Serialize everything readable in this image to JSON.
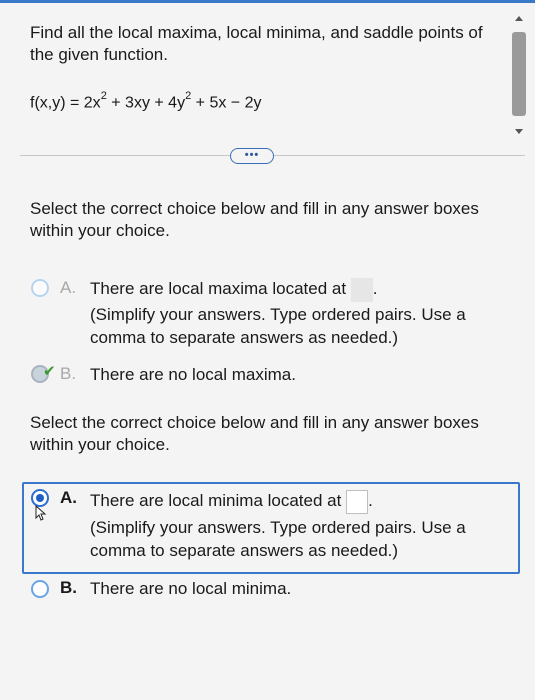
{
  "question": {
    "prompt": "Find all the local maxima, local minima, and saddle points of the given function.",
    "formula": {
      "lhs": "f(x,y) = 2x",
      "exp1": "2",
      "mid": " + 3xy + 4y",
      "exp2": "2",
      "rhs": " + 5x − 2y"
    }
  },
  "more_button": "•••",
  "part1": {
    "instruction": "Select the correct choice below and fill in any answer boxes within your choice.",
    "choice_a": {
      "letter": "A.",
      "text": "There are local maxima located at",
      "hint": "(Simplify your answers. Type ordered pairs. Use a comma to separate answers as needed.)"
    },
    "choice_b": {
      "letter": "B.",
      "text": "There are no local maxima."
    }
  },
  "part2": {
    "instruction": "Select the correct choice below and fill in any answer boxes within your choice.",
    "choice_a": {
      "letter": "A.",
      "text": "There are local minima located at",
      "hint": "(Simplify your answers. Type ordered pairs. Use a comma to separate answers as needed.)"
    },
    "choice_b": {
      "letter": "B.",
      "text": "There are no local minima."
    }
  },
  "colors": {
    "accent": "#3a78c9",
    "correct": "#3a9a2a"
  }
}
